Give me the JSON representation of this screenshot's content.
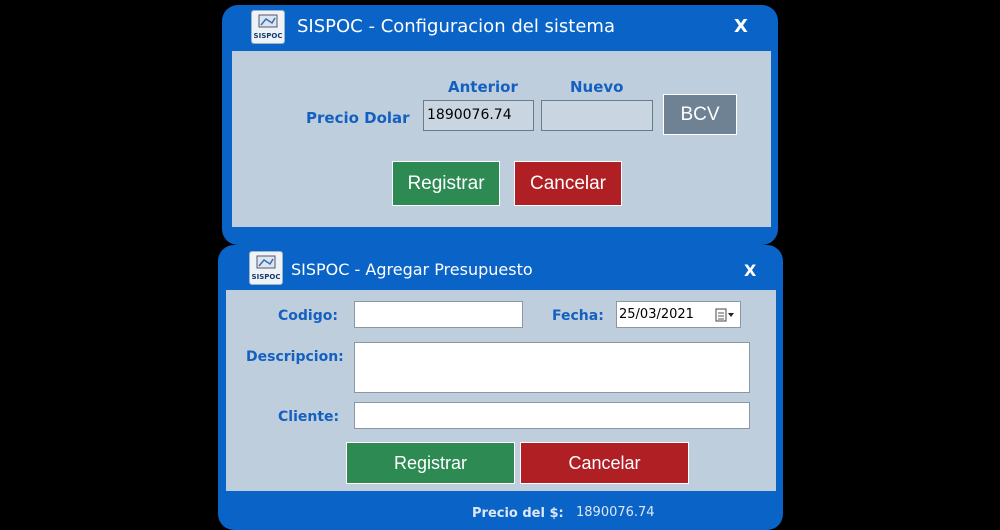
{
  "config_window": {
    "title": "SISPOC - Configuracion del sistema",
    "close_label": "X",
    "col_anterior": "Anterior",
    "col_nuevo": "Nuevo",
    "precio_label": "Precio Dolar",
    "anterior_value": "1890076.74",
    "nuevo_value": "",
    "bcv_label": "BCV",
    "registrar_label": "Registrar",
    "cancelar_label": "Cancelar"
  },
  "budget_window": {
    "title": "SISPOC - Agregar Presupuesto",
    "close_label": "X",
    "codigo_label": "Codigo:",
    "codigo_value": "",
    "fecha_label": "Fecha:",
    "fecha_value": "25/03/2021",
    "descripcion_label": "Descripcion:",
    "descripcion_value": "",
    "cliente_label": "Cliente:",
    "cliente_value": "",
    "registrar_label": "Registrar",
    "cancelar_label": "Cancelar",
    "footer_label": "Precio del $:",
    "footer_value": "1890076.74"
  },
  "logo_text": "SISPOC",
  "colors": {
    "window_blue": "#0a63c7",
    "panel": "#bfcedd",
    "label_blue": "#1460c0",
    "green": "#2d8a52",
    "red": "#b01f24",
    "gray_button": "#6f8294"
  }
}
